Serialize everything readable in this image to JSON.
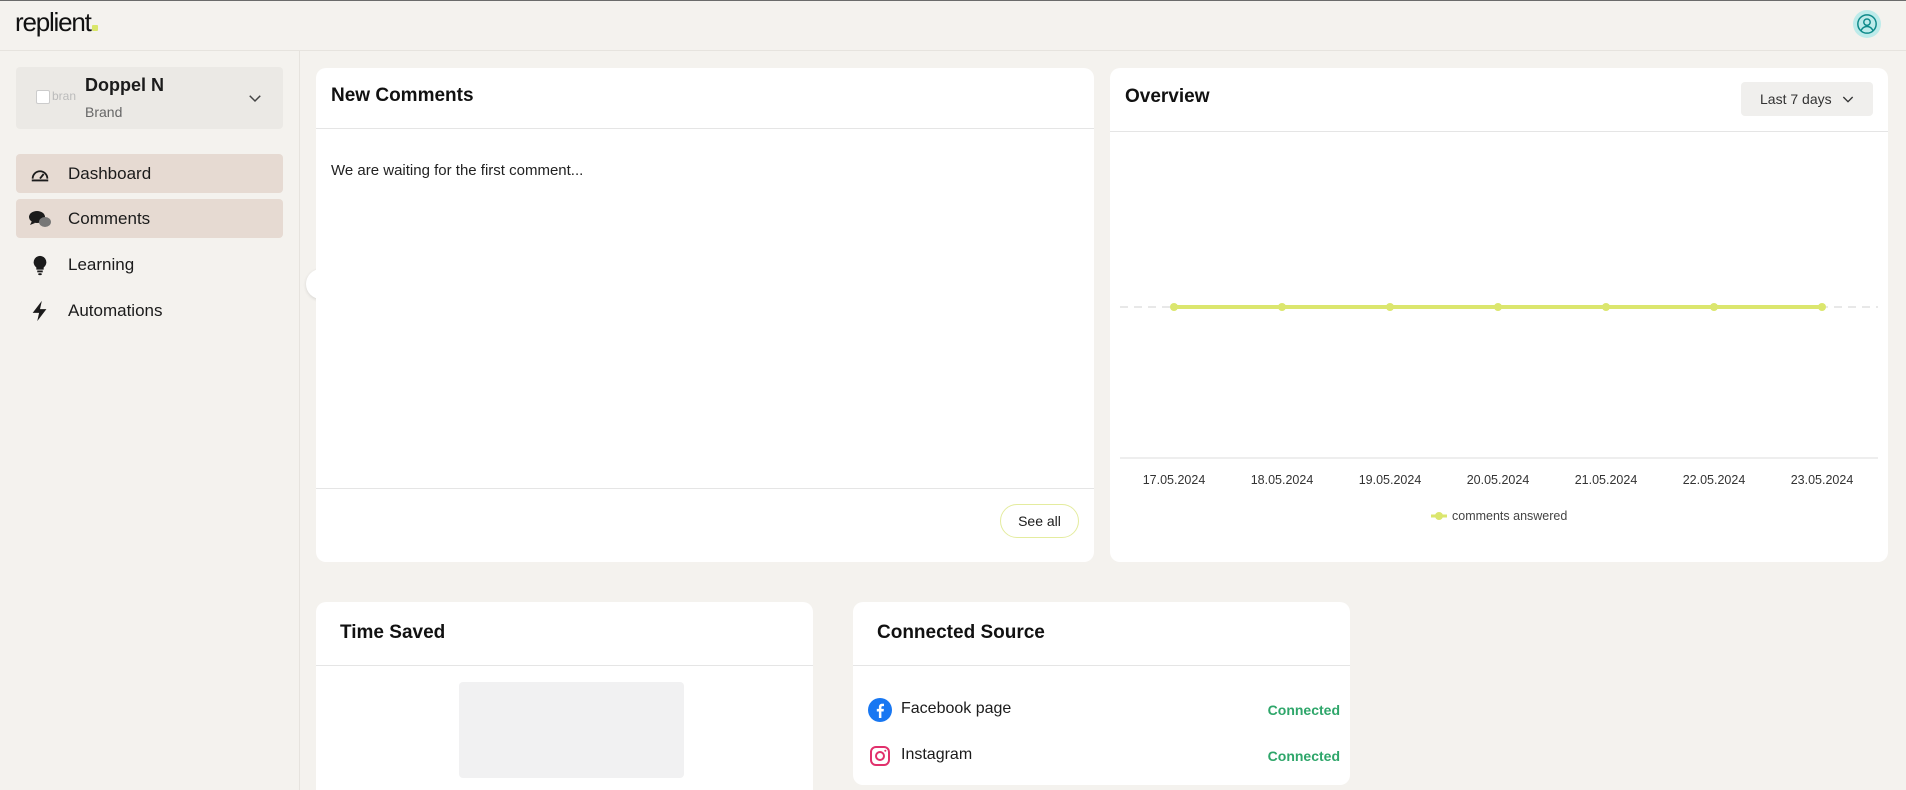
{
  "app": {
    "logo_text": "replient"
  },
  "account": {
    "name": "Doppel N",
    "role": "Brand",
    "image_alt": "brand"
  },
  "nav": [
    {
      "label": "Dashboard",
      "icon": "gauge-icon",
      "active": true
    },
    {
      "label": "Comments",
      "icon": "chat-bubbles-icon",
      "active": true
    },
    {
      "label": "Learning",
      "icon": "lightbulb-icon",
      "active": false
    },
    {
      "label": "Automations",
      "icon": "lightning-icon",
      "active": false
    }
  ],
  "new_comments": {
    "title": "New Comments",
    "empty_text": "We are waiting for the first comment...",
    "see_all_label": "See all"
  },
  "overview": {
    "title": "Overview",
    "range_label": "Last 7 days"
  },
  "chart_data": {
    "type": "line",
    "x": [
      "17.05.2024",
      "18.05.2024",
      "19.05.2024",
      "20.05.2024",
      "21.05.2024",
      "22.05.2024",
      "23.05.2024"
    ],
    "series": [
      {
        "name": "comments answered",
        "values": [
          0,
          0,
          0,
          0,
          0,
          0,
          0
        ],
        "color": "#dbe66e"
      }
    ],
    "grid": false
  },
  "time_saved": {
    "title": "Time Saved"
  },
  "connected_source": {
    "title": "Connected Source",
    "sources": [
      {
        "label": "Facebook page",
        "status": "Connected",
        "icon": "facebook-icon"
      },
      {
        "label": "Instagram",
        "status": "Connected",
        "icon": "instagram-icon"
      }
    ]
  },
  "colors": {
    "accent": "#dbe66e",
    "connected": "#2ea66a",
    "nav_active": "#e6dad2"
  }
}
